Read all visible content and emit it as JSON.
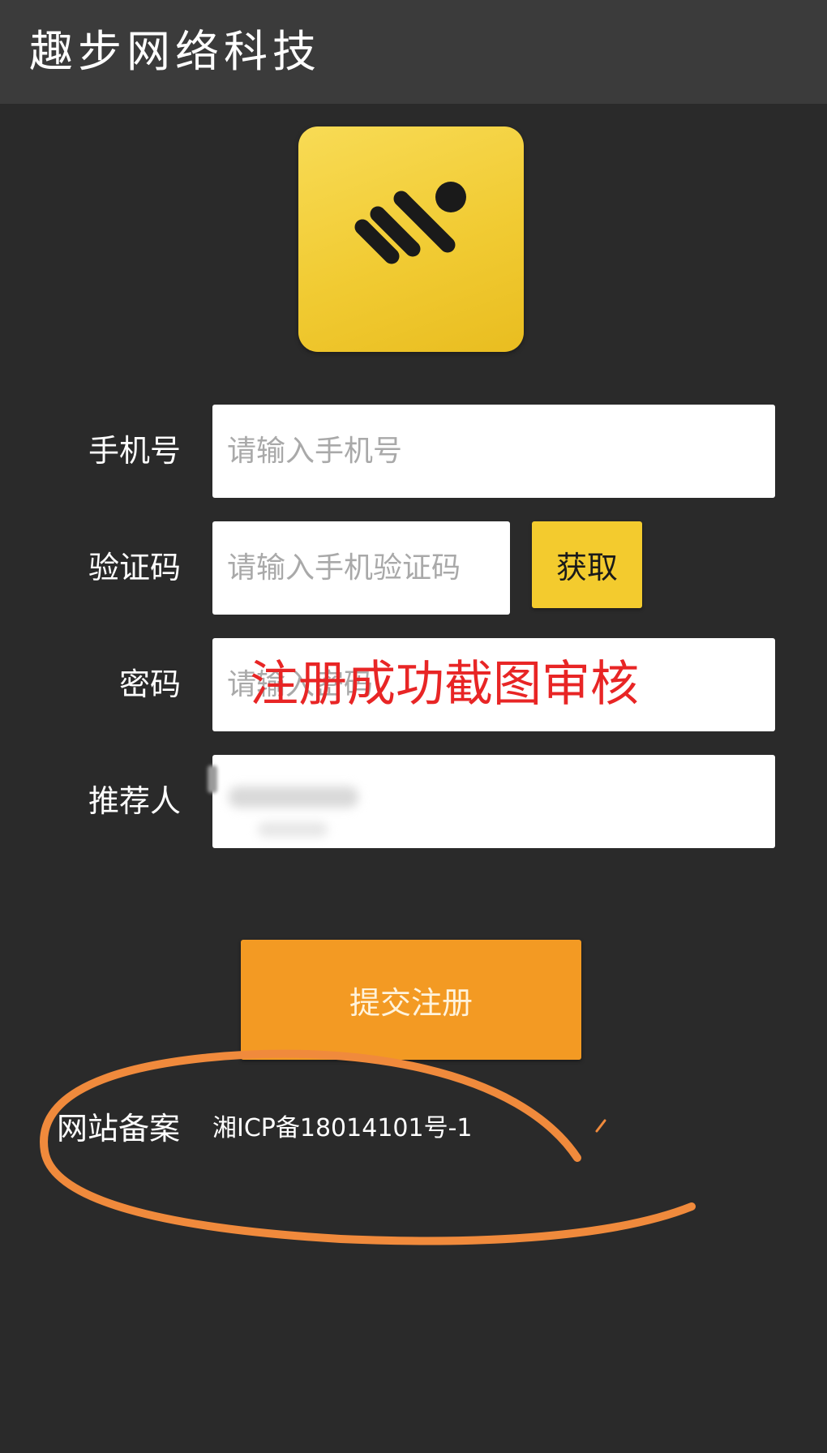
{
  "header": {
    "title": "趣步网络科技"
  },
  "logo": {
    "icon": "running-figure-icon",
    "background_color": "#f3cb2e"
  },
  "form": {
    "phone": {
      "label": "手机号",
      "placeholder": "请输入手机号",
      "value": ""
    },
    "code": {
      "label": "验证码",
      "placeholder": "请输入手机验证码",
      "value": "",
      "get_button_label": "获取"
    },
    "password": {
      "label": "密码",
      "placeholder": "请输入密码",
      "value": ""
    },
    "referrer": {
      "label": "推荐人",
      "value": ""
    },
    "submit_label": "提交注册"
  },
  "overlay": {
    "text": "注册成功截图审核",
    "color": "#e82525"
  },
  "footer": {
    "label": "网站备案",
    "value": "湘ICP备18014101号-1"
  },
  "colors": {
    "page_background": "#2a2a2a",
    "header_background": "#3b3b3b",
    "get_button": "#f3cb2e",
    "submit_button": "#f39a23",
    "scribble": "#f08a3c"
  }
}
